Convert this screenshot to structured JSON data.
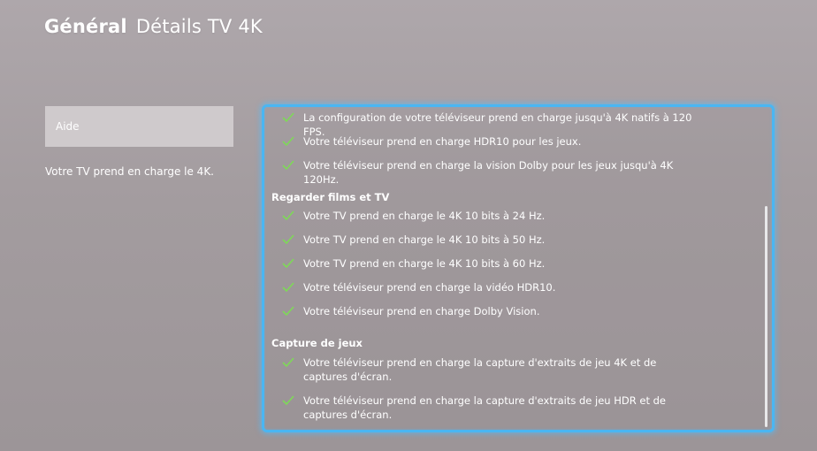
{
  "header": {
    "section": "Général",
    "title": "Détails TV 4K"
  },
  "sidebar": {
    "help_button": "Aide",
    "description": "Votre TV prend en charge le 4K."
  },
  "panel": {
    "items_top": [
      "La configuration de votre téléviseur prend en charge jusqu'à 4K natifs à 120 FPS.",
      "Votre téléviseur prend en charge HDR10 pour les jeux.",
      "Votre téléviseur prend en charge la vision Dolby pour les jeux jusqu'à 4K 120Hz."
    ],
    "section_movies": "Regarder films et TV",
    "items_movies": [
      "Votre TV prend en charge le 4K 10 bits à 24 Hz.",
      "Votre TV prend en charge le 4K 10 bits à 50 Hz.",
      "Votre TV prend en charge le 4K 10 bits à 60 Hz.",
      "Votre téléviseur prend en charge la vidéo HDR10.",
      "Votre téléviseur prend en charge Dolby Vision."
    ],
    "section_capture": "Capture de jeux",
    "items_capture": [
      "Votre téléviseur prend en charge la capture d'extraits de jeu 4K et de captures d'écran.",
      "Votre téléviseur prend en charge la capture d'extraits de jeu HDR et de captures d'écran."
    ]
  },
  "colors": {
    "accent": "#4ab6f2",
    "check": "#7ed957"
  },
  "icons": {
    "check": "check-icon"
  }
}
